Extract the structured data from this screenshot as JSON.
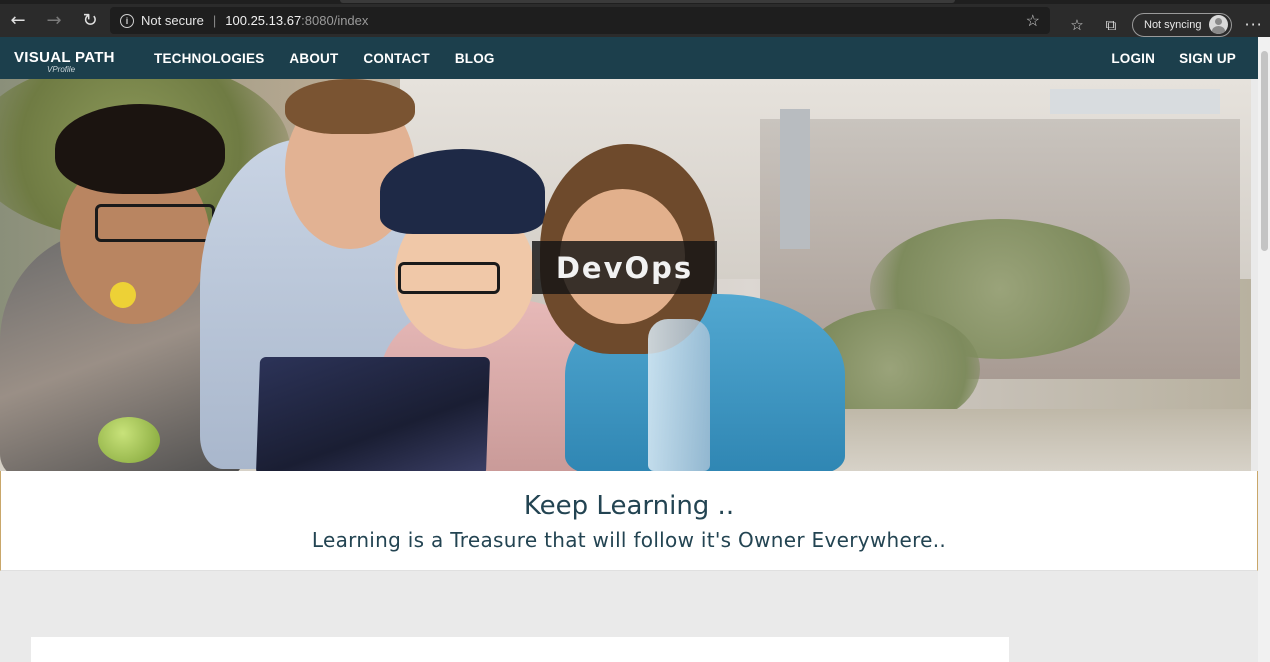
{
  "browser": {
    "security_label": "Not secure",
    "url_host": "100.25.13.67",
    "url_rest": ":8080/index",
    "sync_label": "Not syncing",
    "icons": [
      "back-icon",
      "forward-icon",
      "refresh-icon",
      "info-icon",
      "star-icon",
      "favorites-icon",
      "collections-icon",
      "avatar",
      "more-icon"
    ]
  },
  "site": {
    "brand": "VISUAL PATH",
    "brand_sub": "VProfile",
    "nav": [
      "TECHNOLOGIES",
      "ABOUT",
      "CONTACT",
      "BLOG"
    ],
    "nav_right": [
      "LOGIN",
      "SIGN UP"
    ],
    "nav_color": "#1c3f4c"
  },
  "hero": {
    "caption": "DevOps"
  },
  "quote": {
    "title": "Keep Learning ..",
    "subtitle": "Learning is a Treasure that will follow it's Owner Everywhere.."
  }
}
